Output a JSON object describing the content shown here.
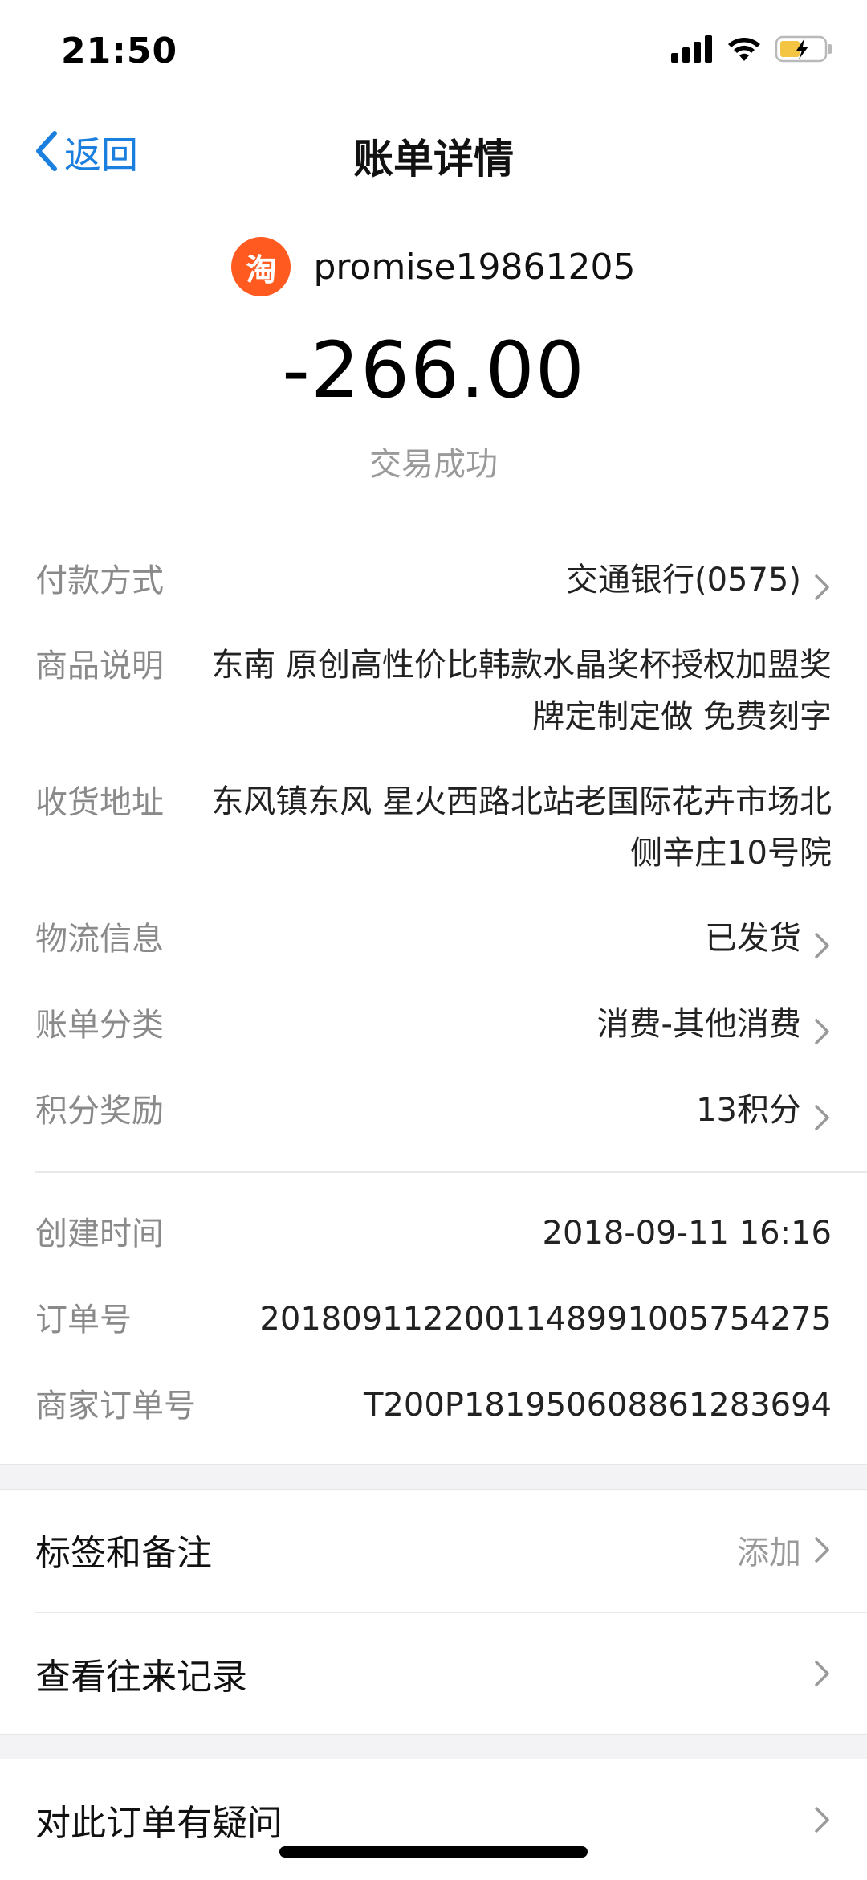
{
  "status_bar": {
    "time": "21:50",
    "icons": [
      "signal-icon",
      "wifi-icon",
      "battery-charging-icon"
    ]
  },
  "nav": {
    "back_label": "返回",
    "title": "账单详情"
  },
  "merchant": {
    "logo_char": "淘",
    "name": "promise19861205"
  },
  "amount": "-266.00",
  "transaction_status": "交易成功",
  "details": {
    "payment_method": {
      "label": "付款方式",
      "value": "交通银行(0575)"
    },
    "product_desc": {
      "label": "商品说明",
      "value": "东南 原创高性价比韩款水晶奖杯授权加盟奖牌定制定做 免费刻字"
    },
    "shipping_address": {
      "label": "收货地址",
      "value": "东风镇东风 星火西路北站老国际花卉市场北侧辛庄10号院"
    },
    "logistics": {
      "label": "物流信息",
      "value": "已发货"
    },
    "category": {
      "label": "账单分类",
      "value": "消费-其他消费"
    },
    "points": {
      "label": "积分奖励",
      "value": "13积分"
    },
    "created_time": {
      "label": "创建时间",
      "value": "2018-09-11 16:16"
    },
    "order_no": {
      "label": "订单号",
      "value": "20180911220011489910057542​75"
    },
    "merchant_order_no": {
      "label": "商家订单号",
      "value": "T200P181950608861283694"
    }
  },
  "actions": {
    "tags_notes": {
      "label": "标签和备注",
      "right": "添加"
    },
    "history": {
      "label": "查看往来记录"
    },
    "question": {
      "label": "对此订单有疑问"
    }
  },
  "colors": {
    "accent": "#1a7fde",
    "taobao_orange": "#ff5a1f",
    "muted_text": "#8a8a8a"
  }
}
